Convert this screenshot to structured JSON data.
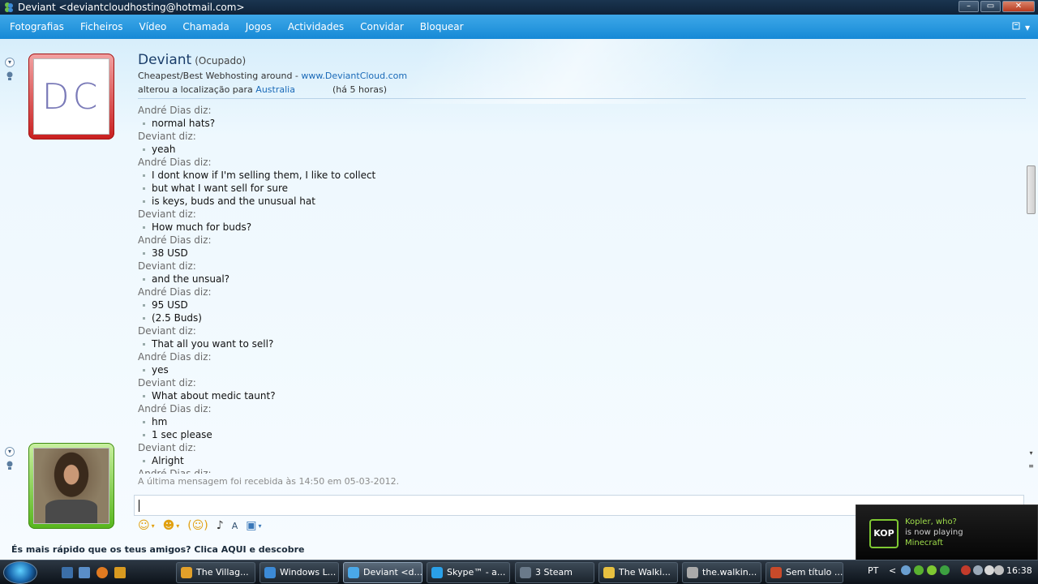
{
  "window": {
    "title": "Deviant <deviantcloudhosting@hotmail.com>",
    "controls": {
      "minimize": "–",
      "maximize": "▭",
      "close": "✕"
    }
  },
  "menu": {
    "items": [
      "Fotografias",
      "Ficheiros",
      "Vídeo",
      "Chamada",
      "Jogos",
      "Actividades",
      "Convidar",
      "Bloquear"
    ],
    "right_icon": "▾"
  },
  "contact": {
    "avatar_text": "DC",
    "name": "Deviant",
    "status": "(Ocupado)",
    "subtitle_prefix": "Cheapest/Best Webhosting around - ",
    "subtitle_link": "www.DeviantCloud.com",
    "location_prefix": "alterou a localização para ",
    "location_link": "Australia",
    "location_time": "(há 5 horas)"
  },
  "conversation": [
    {
      "speaker": "André Dias diz:",
      "messages": [
        "normal hats?"
      ]
    },
    {
      "speaker": "Deviant diz:",
      "messages": [
        "yeah"
      ]
    },
    {
      "speaker": "André Dias diz:",
      "messages": [
        "I dont know if I'm selling them, I like to collect",
        "but what I want sell for sure",
        "is keys, buds and the unusual hat"
      ]
    },
    {
      "speaker": "Deviant diz:",
      "messages": [
        "How much for buds?"
      ]
    },
    {
      "speaker": "André Dias diz:",
      "messages": [
        "38 USD"
      ]
    },
    {
      "speaker": "Deviant diz:",
      "messages": [
        "and the unsual?"
      ]
    },
    {
      "speaker": "André Dias diz:",
      "messages": [
        "95 USD",
        "(2.5 Buds)"
      ]
    },
    {
      "speaker": "Deviant diz:",
      "messages": [
        "That all you want to sell?"
      ]
    },
    {
      "speaker": "André Dias diz:",
      "messages": [
        "yes"
      ]
    },
    {
      "speaker": "Deviant diz:",
      "messages": [
        "What about medic taunt?"
      ]
    },
    {
      "speaker": "André Dias diz:",
      "messages": [
        "hm",
        "1 sec please"
      ]
    },
    {
      "speaker": "Deviant diz:",
      "messages": [
        "Alright"
      ]
    },
    {
      "speaker": "André Dias diz:",
      "messages": []
    }
  ],
  "last_message_info": "A última mensagem foi recebida às 14:50 em 05-03-2012.",
  "input": {
    "value": ""
  },
  "toolbar": {
    "emoticon": "☺",
    "wink": "☻",
    "nudge": "(☺)",
    "voice": "♪",
    "font": "A",
    "background": "▣",
    "chevron": "▾"
  },
  "promo": "És mais rápido que os teus amigos? Clica AQUI e descobre",
  "notification": {
    "logo": "KOP",
    "line1": "Kopler, who?",
    "line2": "is now playing",
    "line3": "Minecraft"
  },
  "taskbar": {
    "buttons": [
      {
        "label": "The Villag...",
        "color": "#e2a02a"
      },
      {
        "label": "Windows L...",
        "color": "#3c8ad6"
      },
      {
        "label": "Deviant <d...",
        "color": "#4aa8e8"
      },
      {
        "label": "Skype™ - a...",
        "color": "#2aa0e8"
      },
      {
        "label": "3 Steam",
        "color": "#6a7a8a"
      },
      {
        "label": "The Walki...",
        "color": "#e8c040"
      },
      {
        "label": "the.walkin...",
        "color": "#aaaaaa"
      },
      {
        "label": "Sem título ...",
        "color": "#c84a2a"
      }
    ],
    "language": "PT",
    "tray_chevron": "<",
    "clock": "16:38"
  }
}
